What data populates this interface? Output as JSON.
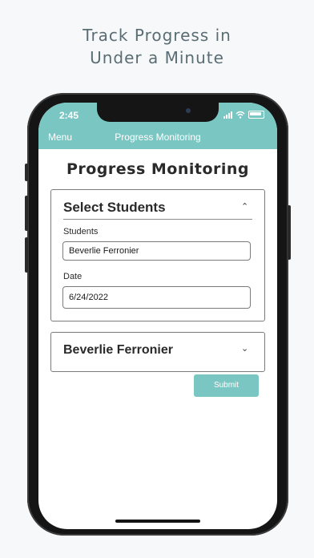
{
  "promo": {
    "line1": "Track Progress in",
    "line2": "Under a Minute"
  },
  "status_bar": {
    "time": "2:45"
  },
  "nav": {
    "menu_label": "Menu",
    "title": "Progress Monitoring"
  },
  "page": {
    "title": "Progress Monitoring"
  },
  "select_section": {
    "title": "Select Students",
    "students_label": "Students",
    "students_value": "Beverlie Ferronier",
    "date_label": "Date",
    "date_value": "6/24/2022"
  },
  "student_section": {
    "name": "Beverlie Ferronier"
  },
  "actions": {
    "submit_label": "Submit"
  },
  "colors": {
    "accent": "#79c6c3",
    "promo_text": "#5a6d74"
  },
  "icons": {
    "collapse": "chevron-up-icon",
    "expand": "chevron-down-icon"
  }
}
